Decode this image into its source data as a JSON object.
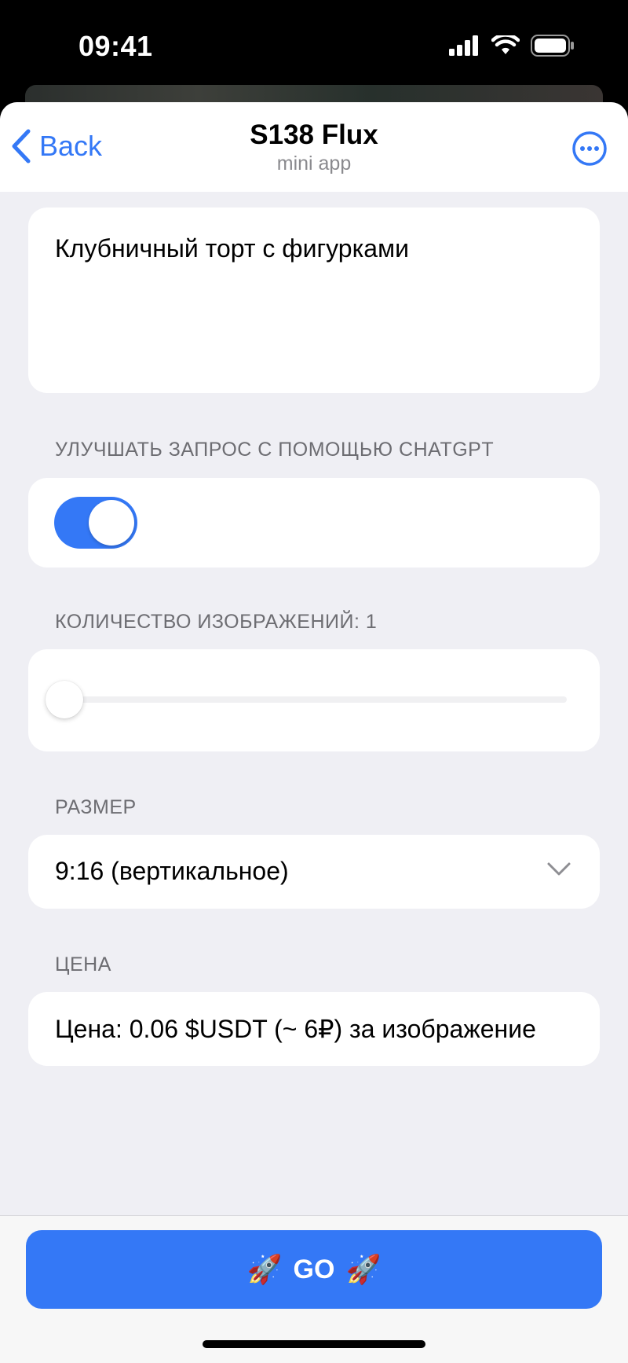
{
  "status_bar": {
    "time": "09:41"
  },
  "nav": {
    "back_label": "Back",
    "title": "S138 Flux",
    "subtitle": "mini app"
  },
  "prompt": {
    "value": "Клубничный торт с фигурками"
  },
  "enhance": {
    "label": "УЛУЧШАТЬ ЗАПРОС С ПОМОЩЬЮ CHATGPT",
    "enabled": true
  },
  "count": {
    "label": "КОЛИЧЕСТВО ИЗОБРАЖЕНИЙ: 1",
    "value": 1
  },
  "size": {
    "label": "РАЗМЕР",
    "selected": "9:16 (вертикальное)"
  },
  "price": {
    "label": "ЦЕНА",
    "text": "Цена: 0.06 $USDT (~ 6₽) за изображение"
  },
  "go_button": {
    "label": "GO",
    "icon": "rocket-emoji"
  },
  "colors": {
    "accent": "#3478f6",
    "background": "#efeff4",
    "card": "#ffffff",
    "secondary_text": "#6d6d72"
  }
}
